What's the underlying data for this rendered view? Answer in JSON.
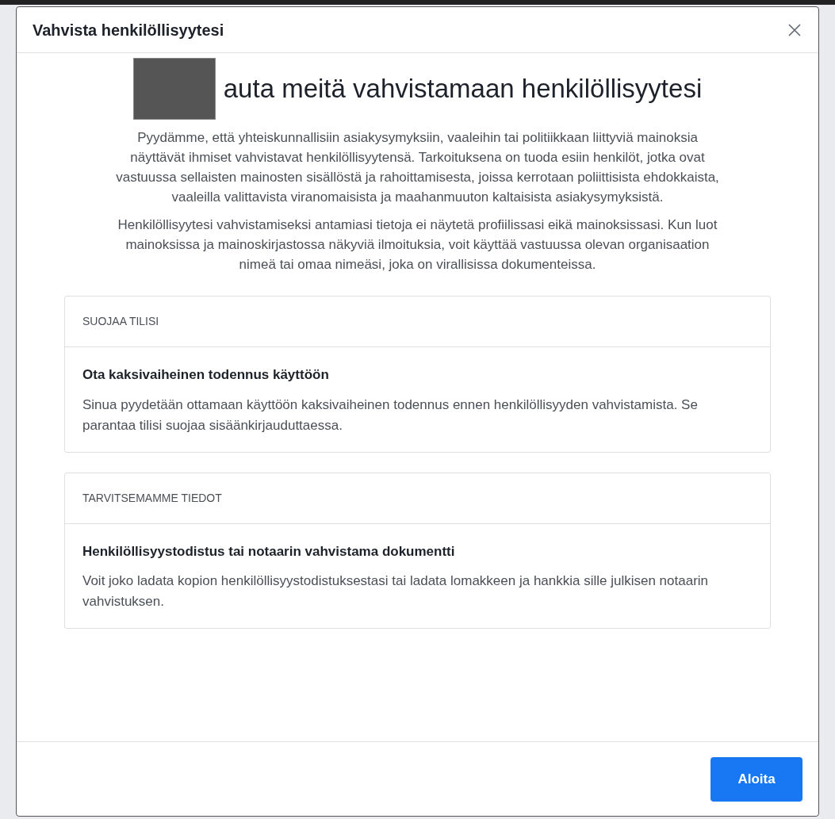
{
  "dialog": {
    "title": "Vahvista henkilöllisyytesi",
    "heading": "auta meitä vahvistamaan henkilöllisyytesi",
    "paragraphs": [
      "Pyydämme, että yhteiskunnallisiin asiakysymyksiin, vaaleihin tai politiikkaan liittyviä mainoksia näyttävät ihmiset vahvistavat henkilöllisyytensä. Tarkoituksena on tuoda esiin henkilöt, jotka ovat vastuussa sellaisten mainosten sisällöstä ja rahoittamisesta, joissa kerrotaan poliittisista ehdokkaista, vaaleilla valittavista viranomaisista ja maahanmuuton kaltaisista asiakysymyksistä.",
      "Henkilöllisyytesi vahvistamiseksi antamiasi tietoja ei näytetä profiilissasi eikä mainoksissasi. Kun luot mainoksissa ja mainoskirjastossa näkyviä ilmoituksia, voit käyttää vastuussa olevan organisaation nimeä tai omaa nimeäsi, joka on virallisissa dokumenteissa."
    ],
    "cards": [
      {
        "header": "SUOJAA TILISI",
        "title": "Ota kaksivaiheinen todennus käyttöön",
        "text": "Sinua pyydetään ottamaan käyttöön kaksivaiheinen todennus ennen henkilöllisyyden vahvistamista. Se parantaa tilisi suojaa sisäänkirjauduttaessa."
      },
      {
        "header": "TARVITSEMAMME TIEDOT",
        "title": "Henkilöllisyystodistus tai notaarin vahvistama dokumentti",
        "text": "Voit joko ladata kopion henkilöllisyystodistuksestasi tai ladata lomakkeen ja hankkia sille julkisen notaarin vahvistuksen."
      }
    ],
    "button": "Aloita"
  }
}
